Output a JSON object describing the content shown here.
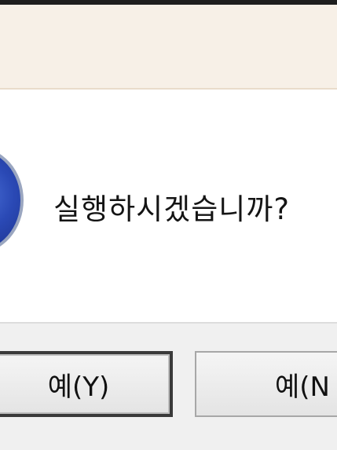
{
  "dialog": {
    "message": "실행하시겠습니까?",
    "icon": "question-icon",
    "buttons": {
      "yes_label": "예(Y)",
      "no_label": "예(N"
    }
  },
  "colors": {
    "title_band": "#f7f0e7",
    "icon_blue": "#2a49b5",
    "button_band": "#f0f0f0"
  }
}
